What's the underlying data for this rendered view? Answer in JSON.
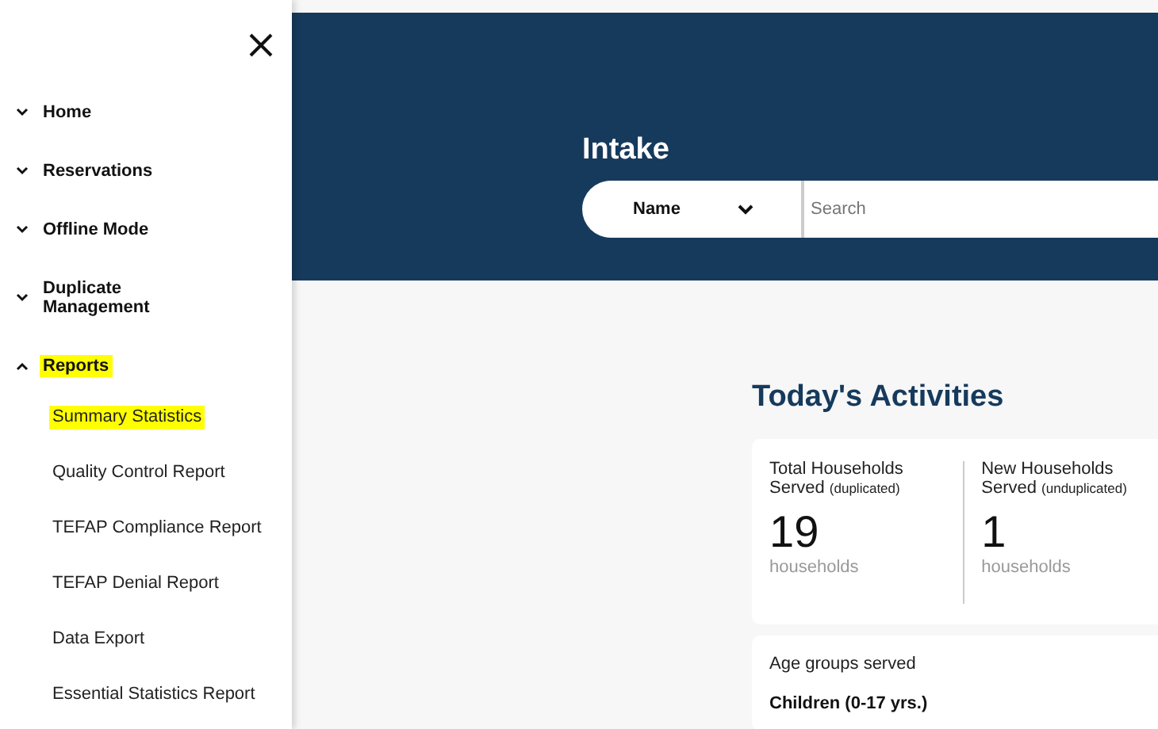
{
  "sidebar": {
    "items": [
      {
        "label": "Home",
        "expanded": false,
        "selected": false
      },
      {
        "label": "Reservations",
        "expanded": false,
        "selected": false
      },
      {
        "label": "Offline Mode",
        "expanded": false,
        "selected": false
      },
      {
        "label": "Duplicate Management",
        "expanded": false,
        "selected": false
      },
      {
        "label": "Reports",
        "expanded": true,
        "selected": true,
        "children": [
          {
            "label": "Summary Statistics",
            "selected": true
          },
          {
            "label": "Quality Control Report",
            "selected": false
          },
          {
            "label": "TEFAP Compliance Report",
            "selected": false
          },
          {
            "label": "TEFAP Denial Report",
            "selected": false
          },
          {
            "label": "Data Export",
            "selected": false
          },
          {
            "label": "Essential Statistics Report",
            "selected": false
          }
        ]
      }
    ]
  },
  "header": {
    "title": "Intake",
    "search": {
      "filter": "Name",
      "placeholder": "Search"
    }
  },
  "activities": {
    "title": "Today's Activities",
    "stats": [
      {
        "label": "Total Households Served",
        "qualifier": "(duplicated)",
        "value": "19",
        "unit": "households"
      },
      {
        "label": "New Households Served",
        "qualifier": "(unduplicated)",
        "value": "1",
        "unit": "households"
      }
    ],
    "age_card": {
      "title": "Age groups served",
      "groups": [
        "Children (0-17 yrs.)"
      ]
    }
  }
}
